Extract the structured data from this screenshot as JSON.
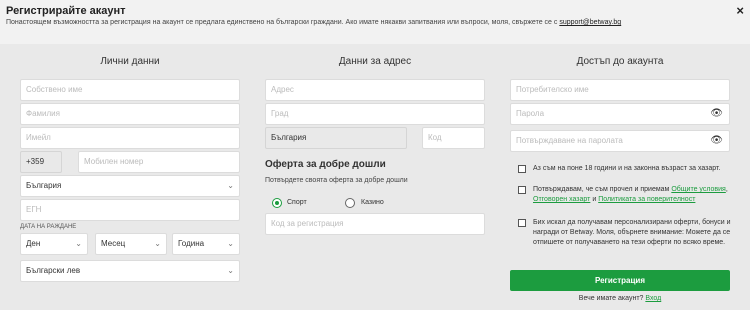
{
  "header": {
    "title": "Регистрирайте акаунт",
    "subtitle": "Понастоящем възможността за регистрация на акаунт се предлага единствено на български граждани. Ако имате някакви запитвания или въпроси, моля, свържете се с",
    "support_link": "support@betway.bg",
    "close": "×"
  },
  "personal": {
    "heading": "Лични данни",
    "first_name_placeholder": "Собствено име",
    "last_name_placeholder": "Фамилия",
    "email_placeholder": "Имейл",
    "phone_code": "+359",
    "mobile_placeholder": "Мобилен номер",
    "country": "България",
    "egn_placeholder": "ЕГН",
    "dob_label": "ДАТА НА РАЖДАНЕ",
    "day": "Ден",
    "month": "Месец",
    "year": "Година",
    "currency": "Български лев"
  },
  "address": {
    "heading": "Данни за адрес",
    "address_placeholder": "Адрес",
    "city_placeholder": "Град",
    "country": "България",
    "zip_placeholder": "Код",
    "offer_title": "Оферта за добре дошли",
    "offer_subtitle": "Потвърдете своята оферта за добре дошли",
    "option_sport": "Спорт",
    "option_casino": "Казино",
    "selected_option": "Спорт",
    "promo_placeholder": "Код за регистрация"
  },
  "account": {
    "heading": "Достъп до акаунта",
    "username_placeholder": "Потребителско име",
    "password_placeholder": "Парола",
    "confirm_placeholder": "Потвърждаване на паролата",
    "check_age": "Аз съм на поне 18 години и на законна възраст за хазарт.",
    "check_terms_prefix": "Потвърждавам, че съм прочел и приемам",
    "terms_link": "Общите условия",
    "responsible_link": "Отговорен хазарт",
    "and_word": "и",
    "privacy_link": "Политиката за поверителност",
    "check_marketing": "Бих искал да получавам персонализирани оферти, бонуси и награди от Betway. Моля, обърнете внимание: Можете да се отпишете от получаването на тези оферти по всяко време.",
    "register_button": "Регистрация",
    "have_account": "Вече имате акаунт?",
    "login_link": "Вход"
  },
  "colors": {
    "accent": "#1c9c3f",
    "panel": "#e9e9e9",
    "header": "#f2f2f2"
  },
  "icons": {
    "close": "close-icon",
    "eye": "eye-icon",
    "chevron": "chevron-down-icon"
  }
}
